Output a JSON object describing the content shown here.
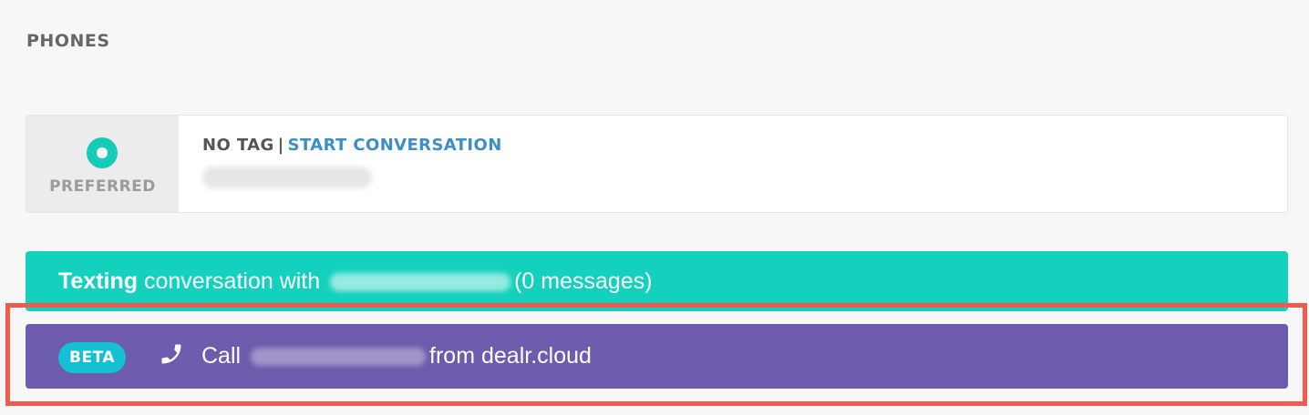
{
  "section_title": "PHONES",
  "phone": {
    "preferred_label": "PREFERRED",
    "tag": "NO TAG",
    "separator": "|",
    "start_conversation": "START CONVERSATION"
  },
  "texting": {
    "label_bold": "Texting",
    "label_rest": "conversation with",
    "count_text": "(0 messages)"
  },
  "call": {
    "beta": "BETA",
    "call_label": "Call",
    "from_text": "from dealr.cloud"
  },
  "colors": {
    "accent_teal": "#14d1bd",
    "call_purple": "#6d5bad",
    "beta_blue": "#16c0d4",
    "link_blue": "#3b8fc4",
    "highlight_red": "#f25a50"
  },
  "icons": {
    "preferred": "preferred-circle-icon",
    "call": "phone-icon"
  }
}
